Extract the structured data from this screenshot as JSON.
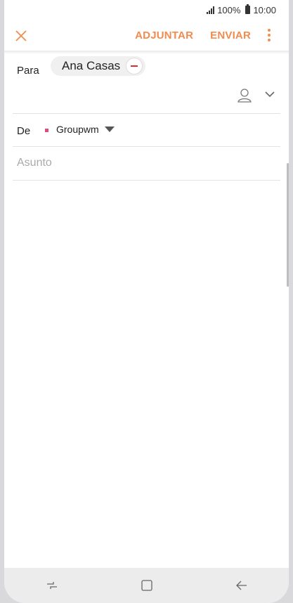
{
  "status_bar": {
    "battery": "100%",
    "time": "10:00"
  },
  "toolbar": {
    "attach_label": "ADJUNTAR",
    "send_label": "ENVIAR"
  },
  "compose": {
    "to_label": "Para",
    "recipient": "Ana Casas",
    "from_label": "De",
    "account": "Groupwm",
    "subject_placeholder": "Asunto"
  },
  "colors": {
    "accent": "#f28c4e",
    "remove": "#e0292d",
    "account_dot": "#e04a7b"
  }
}
